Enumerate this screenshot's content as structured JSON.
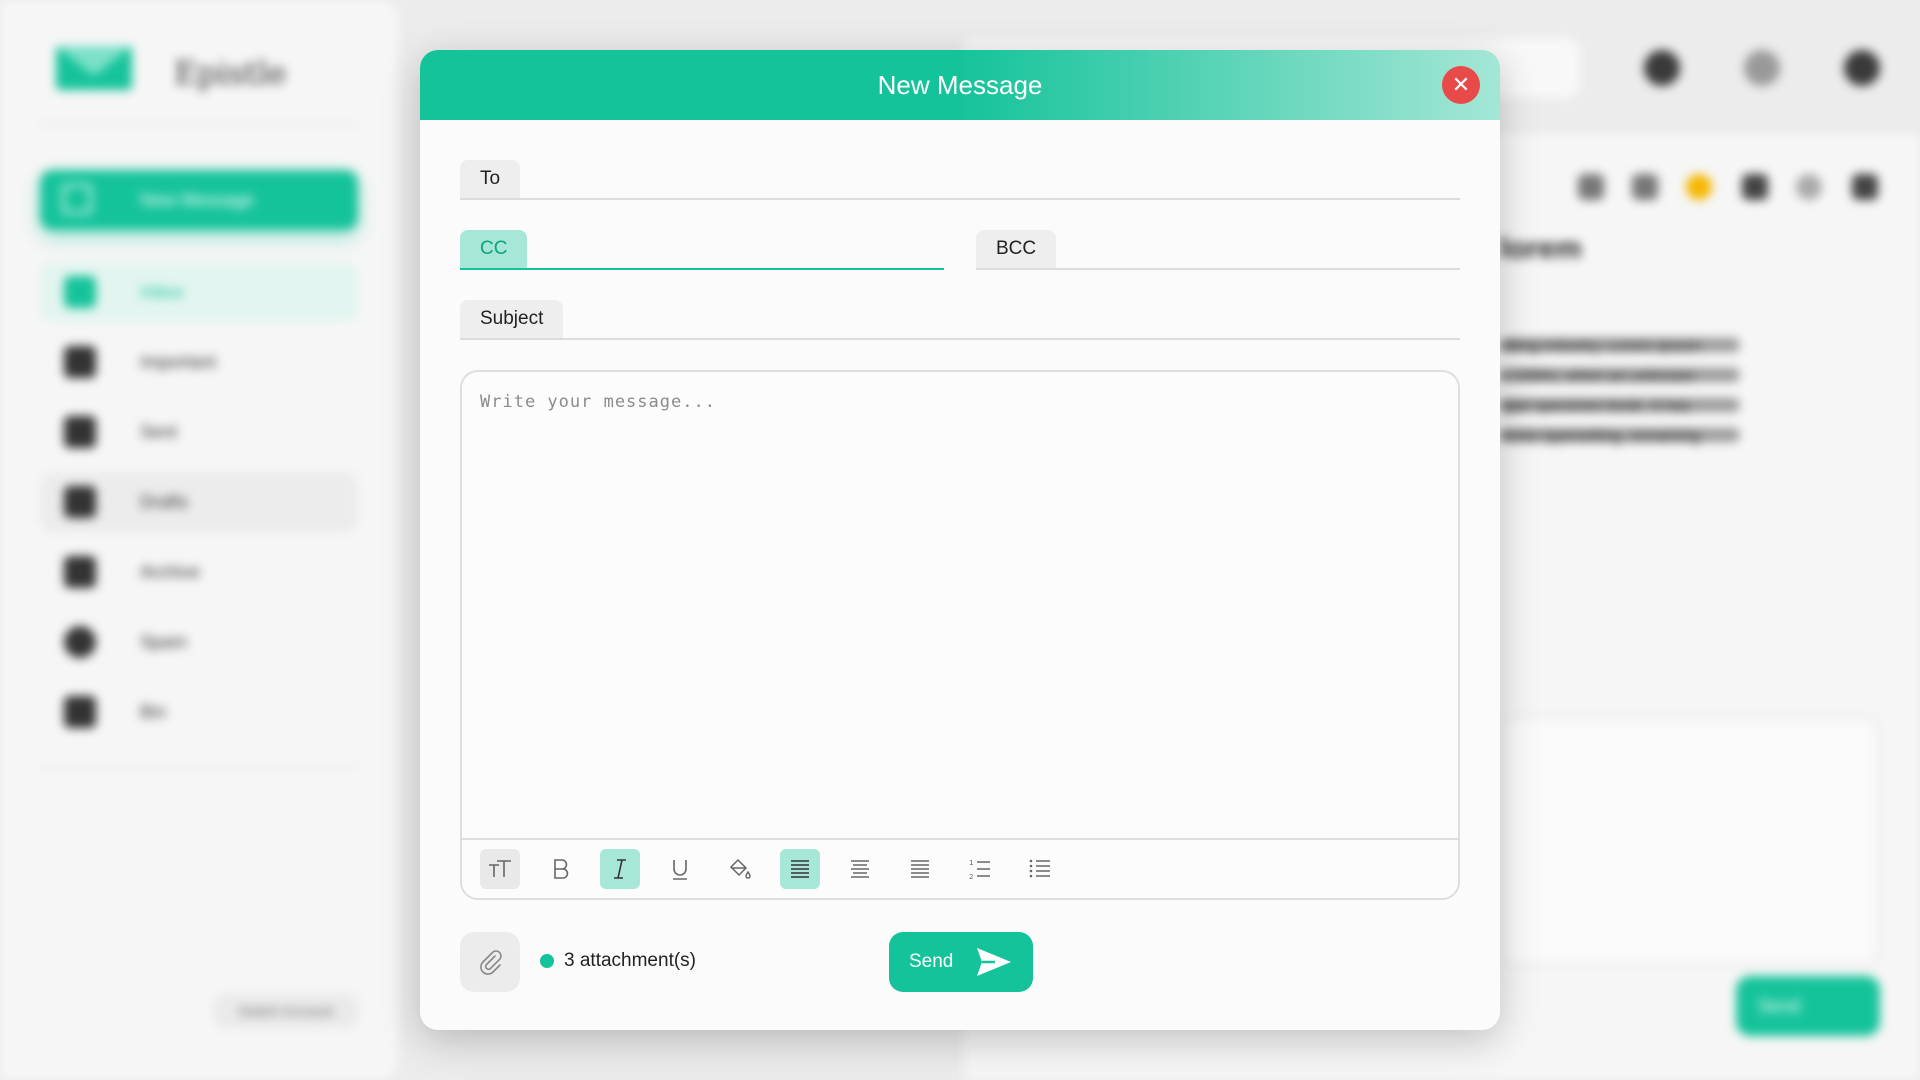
{
  "app": {
    "name": "Epistle",
    "sidebar": {
      "new_message_label": "New Message",
      "items": [
        {
          "label": "Inbox",
          "icon": "inbox-icon"
        },
        {
          "label": "Important",
          "icon": "star-icon"
        },
        {
          "label": "Sent",
          "icon": "sent-icon"
        },
        {
          "label": "Drafts",
          "icon": "drafts-icon"
        },
        {
          "label": "Archive",
          "icon": "archive-icon"
        },
        {
          "label": "Spam",
          "icon": "spam-icon"
        },
        {
          "label": "Bin",
          "icon": "bin-icon"
        }
      ],
      "switch_account_label": "Switch Account"
    },
    "mail": {
      "heading": "lorem",
      "body_lines": [
        "etting industry. Lorem Ipsum",
        "e 1500s, when an unknown",
        "type specimen book. It has",
        "tronic typesetting, remaining"
      ],
      "send_label": "Send"
    }
  },
  "modal": {
    "title": "New Message",
    "close_icon": "close-icon",
    "fields": {
      "to": {
        "label": "To",
        "value": ""
      },
      "cc": {
        "label": "CC",
        "value": ""
      },
      "bcc": {
        "label": "BCC",
        "value": ""
      },
      "subject": {
        "label": "Subject",
        "value": ""
      }
    },
    "message": {
      "placeholder": "Write your message...",
      "value": ""
    },
    "toolbar": [
      {
        "name": "text-size-icon",
        "state": "gray"
      },
      {
        "name": "bold-icon",
        "state": "normal"
      },
      {
        "name": "italic-icon",
        "state": "active"
      },
      {
        "name": "underline-icon",
        "state": "normal"
      },
      {
        "name": "fill-color-icon",
        "state": "normal"
      },
      {
        "name": "align-left-icon",
        "state": "active"
      },
      {
        "name": "align-center-icon",
        "state": "normal"
      },
      {
        "name": "align-justify-icon",
        "state": "normal"
      },
      {
        "name": "ordered-list-icon",
        "state": "normal"
      },
      {
        "name": "unordered-list-icon",
        "state": "normal"
      }
    ],
    "attachments": {
      "status": "3 attachment(s)",
      "count": 3
    },
    "send_label": "Send",
    "colors": {
      "accent": "#15c39a",
      "accent_light": "#a6e7d7",
      "close": "#e84a4a"
    }
  }
}
